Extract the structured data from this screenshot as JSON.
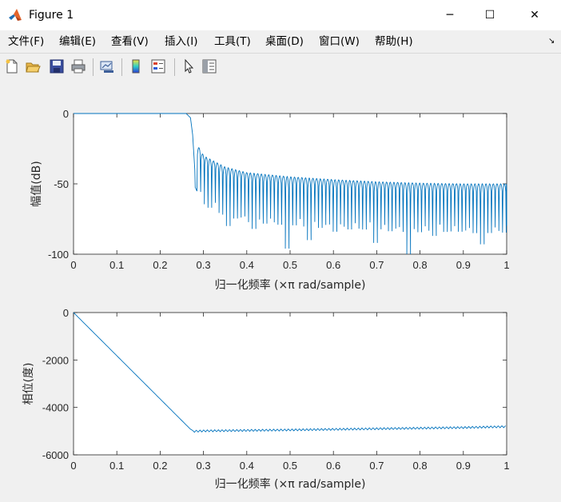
{
  "window": {
    "title": "Figure 1",
    "controls": {
      "minimize": "─",
      "maximize": "☐",
      "close": "✕"
    }
  },
  "menu": {
    "items": [
      "文件(F)",
      "编辑(E)",
      "查看(V)",
      "插入(I)",
      "工具(T)",
      "桌面(D)",
      "窗口(W)",
      "帮助(H)"
    ],
    "overflow_arrow": "↘"
  },
  "toolbar": {
    "buttons": [
      "new-figure-icon",
      "open-file-icon",
      "save-icon",
      "print-icon",
      "link-plot-icon",
      "colorbar-icon",
      "legend-icon",
      "pointer-icon",
      "property-inspector-icon"
    ]
  },
  "chart_data": [
    {
      "type": "line",
      "xlabel": "归一化频率  (×π rad/sample)",
      "ylabel": "幅值(dB)",
      "xlim": [
        0,
        1
      ],
      "ylim": [
        -100,
        0
      ],
      "xticks": [
        "0",
        "0.1",
        "0.2",
        "0.3",
        "0.4",
        "0.5",
        "0.6",
        "0.7",
        "0.8",
        "0.9",
        "1"
      ],
      "yticks": [
        "0",
        "-50",
        "-100"
      ],
      "grid": false,
      "color": "#0072bd",
      "series": [
        {
          "x": [
            0,
            0.1,
            0.2,
            0.26,
            0.27,
            0.275,
            0.28,
            0.282,
            0.285,
            0.3,
            0.35,
            0.4,
            0.5,
            0.6,
            0.7,
            0.8,
            0.9,
            1.0
          ],
          "values": [
            0,
            0,
            0,
            0,
            -3,
            -15,
            -40,
            -65,
            -22,
            -30,
            -38,
            -42,
            -45,
            -47,
            -48.5,
            -49.5,
            -50,
            -50
          ]
        }
      ],
      "notches": [
        {
          "x": 0.282,
          "y": -65
        },
        {
          "x": 0.36,
          "y": -80
        },
        {
          "x": 0.415,
          "y": -82
        },
        {
          "x": 0.49,
          "y": -96
        },
        {
          "x": 0.545,
          "y": -90
        },
        {
          "x": 0.6,
          "y": -84
        },
        {
          "x": 0.695,
          "y": -92
        },
        {
          "x": 0.775,
          "y": -100
        },
        {
          "x": 0.835,
          "y": -87
        },
        {
          "x": 0.89,
          "y": -84
        },
        {
          "x": 0.945,
          "y": -93
        },
        {
          "x": 1.0,
          "y": -82
        }
      ]
    },
    {
      "type": "line",
      "xlabel": "归一化频率  (×π rad/sample)",
      "ylabel": "相位(度)",
      "xlim": [
        0,
        1
      ],
      "ylim": [
        -6000,
        0
      ],
      "xticks": [
        "0",
        "0.1",
        "0.2",
        "0.3",
        "0.4",
        "0.5",
        "0.6",
        "0.7",
        "0.8",
        "0.9",
        "1"
      ],
      "yticks": [
        "0",
        "-2000",
        "-4000",
        "-6000"
      ],
      "grid": false,
      "color": "#0072bd",
      "series": [
        {
          "x": [
            0,
            0.275,
            0.3,
            0.5,
            0.7,
            0.9,
            1.0
          ],
          "values": [
            0,
            -5010,
            -4990,
            -4950,
            -4900,
            -4850,
            -4810
          ]
        }
      ],
      "ripple_amplitude": 40
    }
  ]
}
